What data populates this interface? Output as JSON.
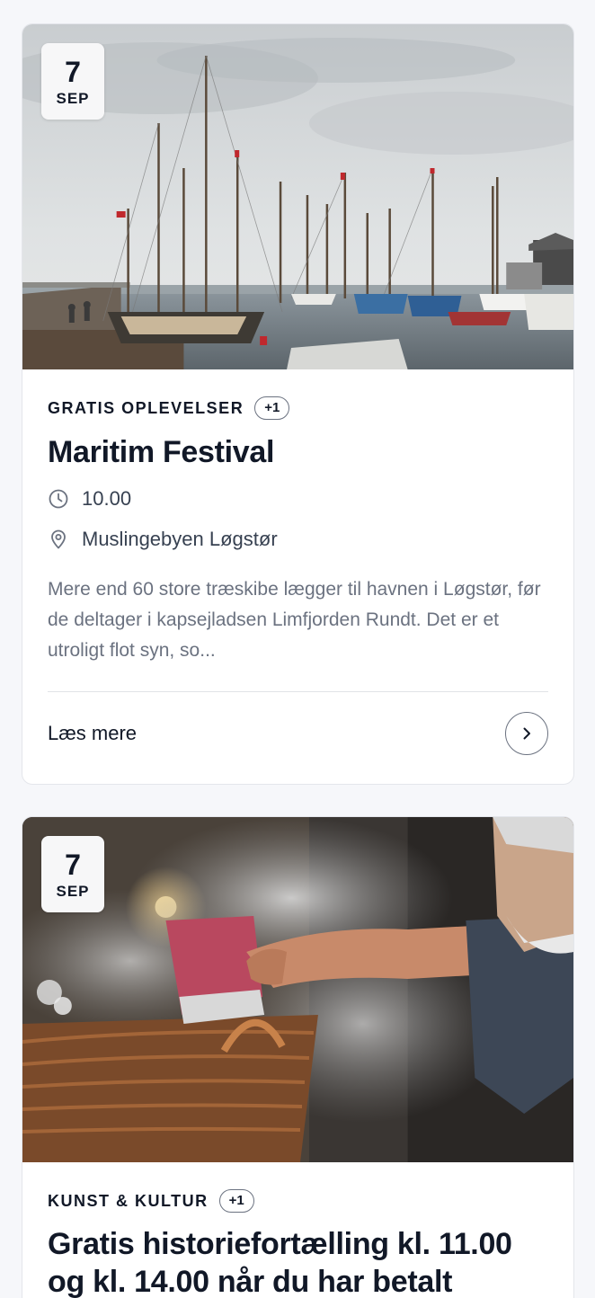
{
  "events": [
    {
      "date_day": "7",
      "date_month": "SEP",
      "category": "GRATIS OPLEVELSER",
      "category_extra": "+1",
      "title": "Maritim Festival",
      "time": "10.00",
      "location": "Muslingebyen Løgstør",
      "description": "Mere end 60 store træskibe lægger til havnen i Løgstør, før de deltager i kapsejladsen Limfjorden Rundt. Det er et utroligt flot syn, so...",
      "read_more": "Læs mere"
    },
    {
      "date_day": "7",
      "date_month": "SEP",
      "category": "KUNST & KULTUR",
      "category_extra": "+1",
      "title": "Gratis historiefortælling kl. 11.00 og kl. 14.00 når du har betalt"
    }
  ],
  "icons": {
    "time": "clock-icon",
    "location": "location-pin-icon",
    "arrow": "chevron-right-icon"
  }
}
